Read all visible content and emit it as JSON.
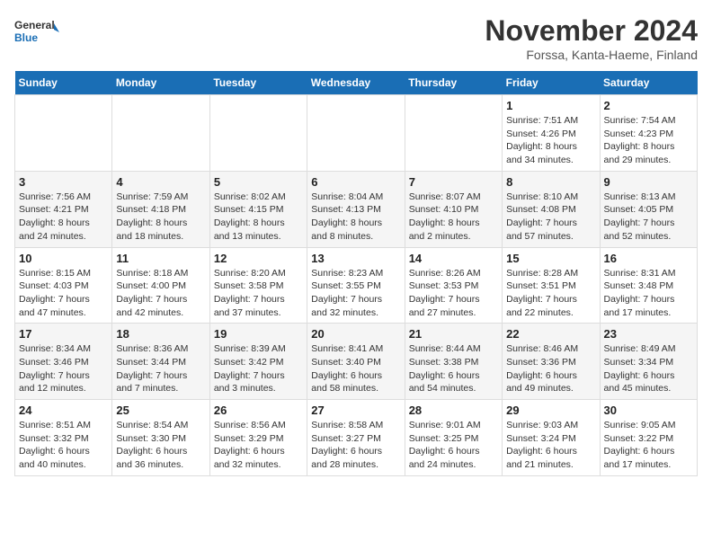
{
  "header": {
    "logo_line1": "General",
    "logo_line2": "Blue",
    "month": "November 2024",
    "location": "Forssa, Kanta-Haeme, Finland"
  },
  "days_of_week": [
    "Sunday",
    "Monday",
    "Tuesday",
    "Wednesday",
    "Thursday",
    "Friday",
    "Saturday"
  ],
  "weeks": [
    [
      {
        "day": "",
        "info": ""
      },
      {
        "day": "",
        "info": ""
      },
      {
        "day": "",
        "info": ""
      },
      {
        "day": "",
        "info": ""
      },
      {
        "day": "",
        "info": ""
      },
      {
        "day": "1",
        "info": "Sunrise: 7:51 AM\nSunset: 4:26 PM\nDaylight: 8 hours\nand 34 minutes."
      },
      {
        "day": "2",
        "info": "Sunrise: 7:54 AM\nSunset: 4:23 PM\nDaylight: 8 hours\nand 29 minutes."
      }
    ],
    [
      {
        "day": "3",
        "info": "Sunrise: 7:56 AM\nSunset: 4:21 PM\nDaylight: 8 hours\nand 24 minutes."
      },
      {
        "day": "4",
        "info": "Sunrise: 7:59 AM\nSunset: 4:18 PM\nDaylight: 8 hours\nand 18 minutes."
      },
      {
        "day": "5",
        "info": "Sunrise: 8:02 AM\nSunset: 4:15 PM\nDaylight: 8 hours\nand 13 minutes."
      },
      {
        "day": "6",
        "info": "Sunrise: 8:04 AM\nSunset: 4:13 PM\nDaylight: 8 hours\nand 8 minutes."
      },
      {
        "day": "7",
        "info": "Sunrise: 8:07 AM\nSunset: 4:10 PM\nDaylight: 8 hours\nand 2 minutes."
      },
      {
        "day": "8",
        "info": "Sunrise: 8:10 AM\nSunset: 4:08 PM\nDaylight: 7 hours\nand 57 minutes."
      },
      {
        "day": "9",
        "info": "Sunrise: 8:13 AM\nSunset: 4:05 PM\nDaylight: 7 hours\nand 52 minutes."
      }
    ],
    [
      {
        "day": "10",
        "info": "Sunrise: 8:15 AM\nSunset: 4:03 PM\nDaylight: 7 hours\nand 47 minutes."
      },
      {
        "day": "11",
        "info": "Sunrise: 8:18 AM\nSunset: 4:00 PM\nDaylight: 7 hours\nand 42 minutes."
      },
      {
        "day": "12",
        "info": "Sunrise: 8:20 AM\nSunset: 3:58 PM\nDaylight: 7 hours\nand 37 minutes."
      },
      {
        "day": "13",
        "info": "Sunrise: 8:23 AM\nSunset: 3:55 PM\nDaylight: 7 hours\nand 32 minutes."
      },
      {
        "day": "14",
        "info": "Sunrise: 8:26 AM\nSunset: 3:53 PM\nDaylight: 7 hours\nand 27 minutes."
      },
      {
        "day": "15",
        "info": "Sunrise: 8:28 AM\nSunset: 3:51 PM\nDaylight: 7 hours\nand 22 minutes."
      },
      {
        "day": "16",
        "info": "Sunrise: 8:31 AM\nSunset: 3:48 PM\nDaylight: 7 hours\nand 17 minutes."
      }
    ],
    [
      {
        "day": "17",
        "info": "Sunrise: 8:34 AM\nSunset: 3:46 PM\nDaylight: 7 hours\nand 12 minutes."
      },
      {
        "day": "18",
        "info": "Sunrise: 8:36 AM\nSunset: 3:44 PM\nDaylight: 7 hours\nand 7 minutes."
      },
      {
        "day": "19",
        "info": "Sunrise: 8:39 AM\nSunset: 3:42 PM\nDaylight: 7 hours\nand 3 minutes."
      },
      {
        "day": "20",
        "info": "Sunrise: 8:41 AM\nSunset: 3:40 PM\nDaylight: 6 hours\nand 58 minutes."
      },
      {
        "day": "21",
        "info": "Sunrise: 8:44 AM\nSunset: 3:38 PM\nDaylight: 6 hours\nand 54 minutes."
      },
      {
        "day": "22",
        "info": "Sunrise: 8:46 AM\nSunset: 3:36 PM\nDaylight: 6 hours\nand 49 minutes."
      },
      {
        "day": "23",
        "info": "Sunrise: 8:49 AM\nSunset: 3:34 PM\nDaylight: 6 hours\nand 45 minutes."
      }
    ],
    [
      {
        "day": "24",
        "info": "Sunrise: 8:51 AM\nSunset: 3:32 PM\nDaylight: 6 hours\nand 40 minutes."
      },
      {
        "day": "25",
        "info": "Sunrise: 8:54 AM\nSunset: 3:30 PM\nDaylight: 6 hours\nand 36 minutes."
      },
      {
        "day": "26",
        "info": "Sunrise: 8:56 AM\nSunset: 3:29 PM\nDaylight: 6 hours\nand 32 minutes."
      },
      {
        "day": "27",
        "info": "Sunrise: 8:58 AM\nSunset: 3:27 PM\nDaylight: 6 hours\nand 28 minutes."
      },
      {
        "day": "28",
        "info": "Sunrise: 9:01 AM\nSunset: 3:25 PM\nDaylight: 6 hours\nand 24 minutes."
      },
      {
        "day": "29",
        "info": "Sunrise: 9:03 AM\nSunset: 3:24 PM\nDaylight: 6 hours\nand 21 minutes."
      },
      {
        "day": "30",
        "info": "Sunrise: 9:05 AM\nSunset: 3:22 PM\nDaylight: 6 hours\nand 17 minutes."
      }
    ]
  ]
}
